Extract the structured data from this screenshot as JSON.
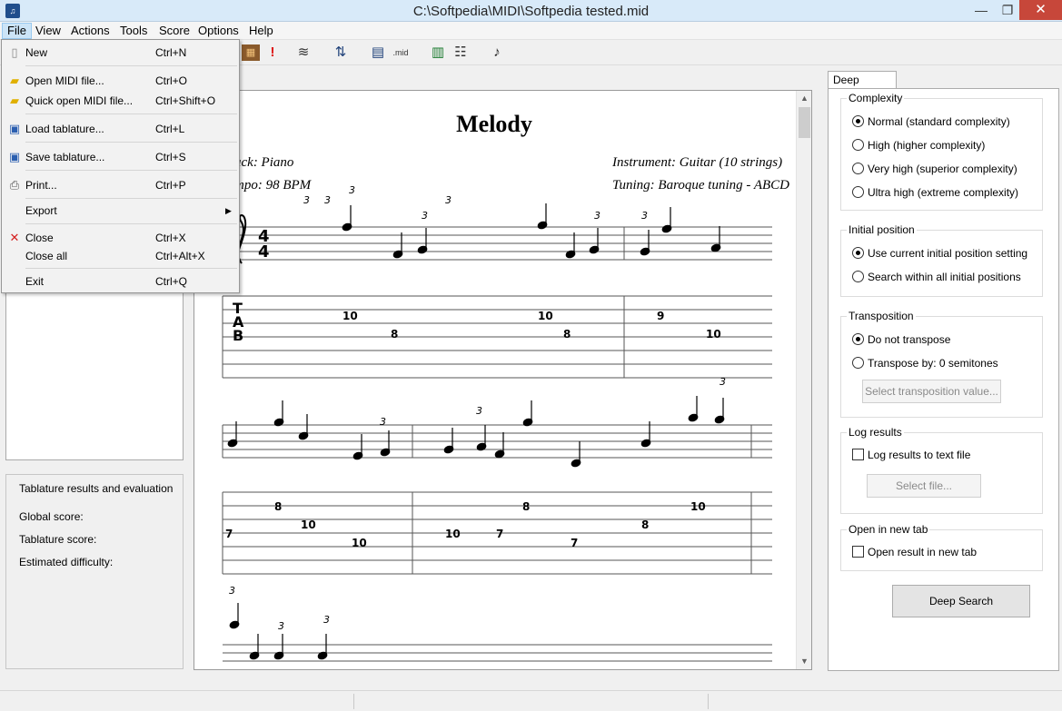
{
  "window": {
    "title": "C:\\Softpedia\\MIDI\\Softpedia tested.mid",
    "minimize": "—",
    "maximize": "❐",
    "close": "✕"
  },
  "menu": [
    "File",
    "View",
    "Actions",
    "Tools",
    "Score",
    "Options",
    "Help"
  ],
  "file_menu": {
    "new": {
      "label": "New",
      "shortcut": "Ctrl+N"
    },
    "open_midi": {
      "label": "Open MIDI file...",
      "shortcut": "Ctrl+O"
    },
    "quick_open": {
      "label": "Quick open MIDI file...",
      "shortcut": "Ctrl+Shift+O"
    },
    "load_tab": {
      "label": "Load tablature...",
      "shortcut": "Ctrl+L"
    },
    "save_tab": {
      "label": "Save tablature...",
      "shortcut": "Ctrl+S"
    },
    "print": {
      "label": "Print...",
      "shortcut": "Ctrl+P"
    },
    "export": {
      "label": "Export",
      "submenu_arrow": "▶"
    },
    "close": {
      "label": "Close",
      "shortcut": "Ctrl+X"
    },
    "close_all": {
      "label": "Close all",
      "shortcut": "Ctrl+Alt+X"
    },
    "exit": {
      "label": "Exit",
      "shortcut": "Ctrl+Q"
    }
  },
  "toolbar": {
    "mid_label": ".mid"
  },
  "results": {
    "title": "Tablature results and evaluation",
    "global_score": "Global score:",
    "tablature_score": "Tablature score:",
    "estimated_difficulty": "Estimated difficulty:"
  },
  "score": {
    "title": "Melody",
    "track": "ack: Piano",
    "tempo": "mpo: 98 BPM",
    "instrument": "Instrument: Guitar (10 strings)",
    "tuning": "Tuning: Baroque tuning - ABCD",
    "tab_letters": [
      "T",
      "A",
      "B"
    ],
    "time_signature": [
      "4",
      "4"
    ],
    "triplet_mark": "3",
    "tab_numbers_row1": [
      "10",
      "8",
      "10",
      "8",
      "9",
      "10"
    ],
    "tab_numbers_row2": [
      "8",
      "7",
      "10",
      "10",
      "10",
      "7",
      "8",
      "7",
      "8",
      "10"
    ]
  },
  "deep_search": {
    "tab_label": "Deep Search",
    "complexity": {
      "title": "Complexity",
      "options": [
        "Normal (standard complexity)",
        "High (higher complexity)",
        "Very high (superior complexity)",
        "Ultra high (extreme complexity)"
      ],
      "selected": 0
    },
    "initial_position": {
      "title": "Initial position",
      "options": [
        "Use current initial position setting",
        "Search within all initial positions"
      ],
      "selected": 0
    },
    "transposition": {
      "title": "Transposition",
      "options": [
        "Do not transpose",
        "Transpose by: 0 semitones"
      ],
      "selected": 0,
      "select_button": "Select transposition value..."
    },
    "log_results": {
      "title": "Log results",
      "checkbox": "Log results to text file",
      "checked": false,
      "select_button": "Select file..."
    },
    "new_tab": {
      "title": "Open in new tab",
      "checkbox": "Open result in new tab",
      "checked": false
    },
    "button": "Deep Search"
  },
  "colors": {
    "titlebar": "#d8eaf9",
    "close_button": "#c7473a",
    "menu_highlight": "#cce4f7"
  }
}
